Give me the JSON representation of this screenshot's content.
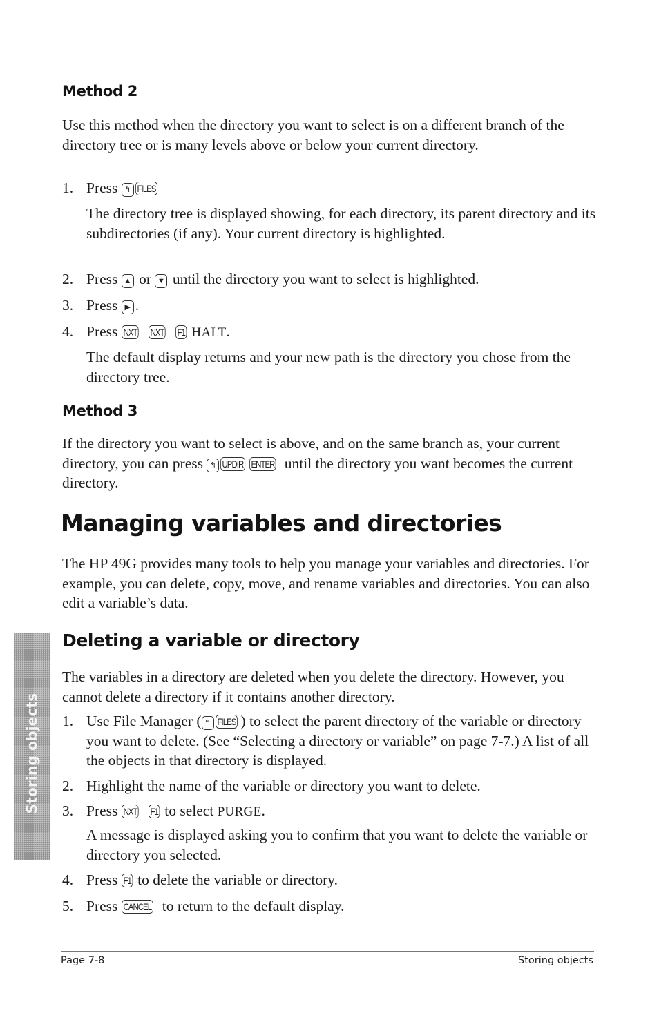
{
  "method2": {
    "heading": "Method 2",
    "intro": "Use this method when the directory you want to select is on a different branch of the directory tree or is many levels above or below your current directory.",
    "steps": [
      {
        "num": "1.",
        "pre": "Press ",
        "keys": [
          "left-shift",
          "FILES"
        ],
        "post": ""
      },
      {
        "num": "2.",
        "pre": "Press ",
        "key_a": "up-arrow",
        "mid": " or ",
        "key_b": "down-arrow",
        "post": " until the directory you want to select is highlighted."
      },
      {
        "num": "3.",
        "pre": "Press ",
        "key": "right-arrow",
        "post": "."
      },
      {
        "num": "4.",
        "pre": "Press ",
        "keys": [
          "NXT",
          "NXT",
          "F1"
        ],
        "menu": "HALT",
        "post": "."
      }
    ],
    "step1_note": "The directory tree is displayed showing, for each directory, its parent directory and its subdirectories (if any). Your current directory is highlighted.",
    "step4_note": "The default display returns and your new path is the directory you chose from the directory tree."
  },
  "method3": {
    "heading": "Method 3",
    "text_pre": "If the directory you want to select is above, and on the same branch as, your current directory, you can press ",
    "keys": [
      "left-shift",
      "UPDIR",
      "ENTER"
    ],
    "text_post": " until the directory you want becomes the current directory."
  },
  "managing": {
    "heading": "Managing variables and directories",
    "intro": "The HP 49G provides many tools to help you manage your variables and directories. For example, you can delete, copy, move, and rename variables and directories. You can also edit a variable’s data."
  },
  "deleting": {
    "heading": "Deleting a variable or directory",
    "intro": "The variables in a directory are deleted when you delete the directory. However, you cannot delete a directory if it contains another directory.",
    "steps": [
      {
        "num": "1.",
        "pre": "Use File Manager (",
        "keys": [
          "left-shift",
          "FILES"
        ],
        "post": ") to select the parent directory of the variable or directory you want to delete. (See “Selecting a directory or variable” on page 7-7.) A list of all the objects in that directory is displayed."
      },
      {
        "num": "2.",
        "text": "Highlight the name of the variable or directory you want to delete."
      },
      {
        "num": "3.",
        "pre": "Press ",
        "keys": [
          "NXT",
          "F1"
        ],
        "mid": " to select ",
        "menu": "PURGE",
        "post": "."
      },
      {
        "num": "4.",
        "pre": "Press ",
        "keys": [
          "F1"
        ],
        "post": " to delete the variable or directory."
      },
      {
        "num": "5.",
        "pre": "Press ",
        "keys": [
          "CANCEL"
        ],
        "post": " to return to the default display."
      }
    ],
    "step3_note": "A message is displayed asking you to confirm that you want to delete the variable or directory you selected."
  },
  "side_tab": {
    "label": "Storing objects"
  },
  "footer": {
    "page": "Page 7-8",
    "chapter": "Storing objects"
  },
  "icons": {
    "left-shift": "↰",
    "up-arrow": "▲",
    "down-arrow": "▼",
    "right-arrow": "▶"
  }
}
